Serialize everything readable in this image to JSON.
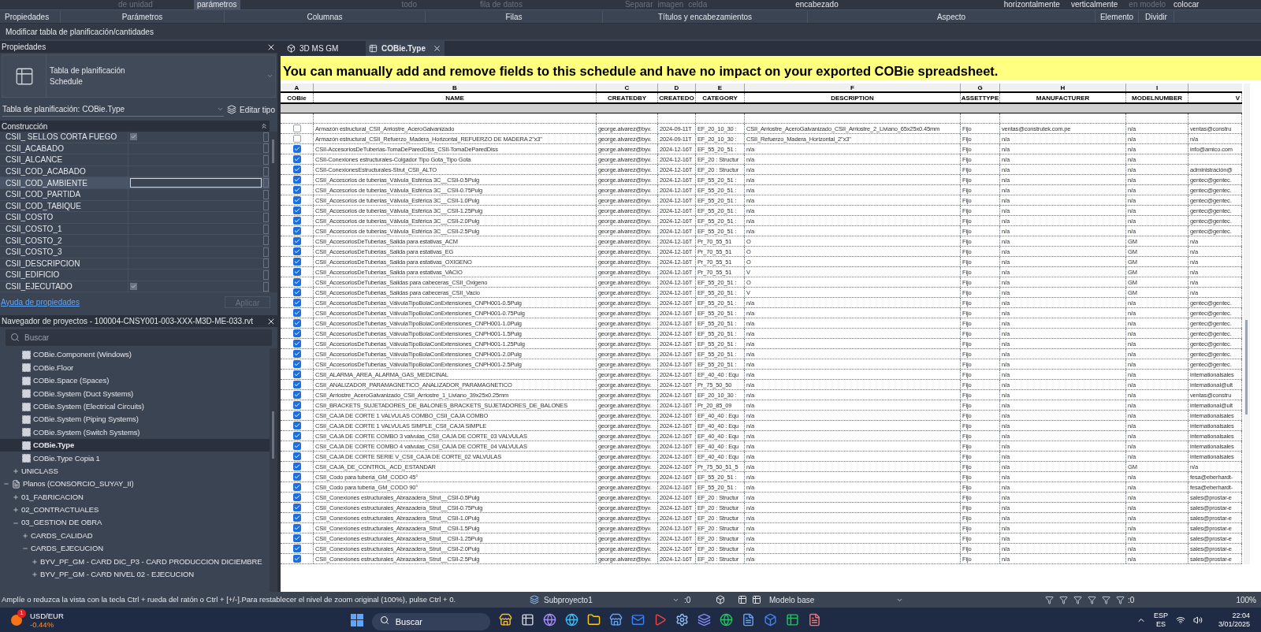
{
  "ribbon": {
    "tools": [
      {
        "label": "de unidad",
        "disabled": true,
        "selected": false
      },
      {
        "label": "parámetros",
        "disabled": false,
        "selected": true
      },
      {
        "label": "todo",
        "disabled": true,
        "selected": false
      },
      {
        "label": "fila de datos",
        "disabled": true,
        "selected": false
      },
      {
        "label": "Separar",
        "disabled": true,
        "selected": false
      },
      {
        "label": "imagen",
        "disabled": true,
        "selected": false
      },
      {
        "label": "celda",
        "disabled": true,
        "selected": false
      },
      {
        "label": "encabezado",
        "disabled": false,
        "selected": false
      },
      {
        "label": "horizontalmente",
        "disabled": false,
        "selected": false
      },
      {
        "label": "verticalmente",
        "disabled": false,
        "selected": false
      },
      {
        "label": "en modelo",
        "disabled": true,
        "selected": false
      },
      {
        "label": "colocar",
        "disabled": false,
        "selected": false
      }
    ],
    "panels": [
      "Propiedades",
      "Parámetros",
      "Columnas",
      "Filas",
      "Títulos y encabezamientos",
      "Aspecto",
      "Elemento",
      "Dividir"
    ],
    "context": "Modificar tabla de planificación/cantidades"
  },
  "properties": {
    "title": "Propiedades",
    "type_name": "Tabla de planificación",
    "type_sub": "Schedule",
    "selector": "Tabla de planificación: COBie.Type",
    "edit_type": "Editar tipo",
    "group": "Construcción",
    "rows": [
      {
        "label": "CSII_ SELLOS CORTA FUEGO",
        "kind": "checkbox",
        "checked": true,
        "selected": false
      },
      {
        "label": "CSII_ACABADO",
        "kind": "text",
        "selected": false
      },
      {
        "label": "CSII_ALCANCE",
        "kind": "text",
        "selected": false
      },
      {
        "label": "CSII_COD_ACABADO",
        "kind": "text",
        "selected": false
      },
      {
        "label": "CSII_COD_AMBIENTE",
        "kind": "text",
        "selected": true
      },
      {
        "label": "CSII_COD_PARTIDA",
        "kind": "text",
        "selected": false
      },
      {
        "label": "CSII_COD_TABIQUE",
        "kind": "text",
        "selected": false
      },
      {
        "label": "CSII_COSTO",
        "kind": "text",
        "selected": false
      },
      {
        "label": "CSII_COSTO_1",
        "kind": "text",
        "selected": false
      },
      {
        "label": "CSII_COSTO_2",
        "kind": "text",
        "selected": false
      },
      {
        "label": "CSII_COSTO_3",
        "kind": "text",
        "selected": false
      },
      {
        "label": "CSII_DESCRIPCION",
        "kind": "text",
        "selected": false
      },
      {
        "label": "CSII_EDIFICIO",
        "kind": "text",
        "selected": false
      },
      {
        "label": "CSII_EJECUTADO",
        "kind": "checkbox",
        "checked": true,
        "selected": false
      }
    ],
    "help_link": "Ayuda de propiedades",
    "apply": {
      "label": "Aplicar",
      "disabled": true
    }
  },
  "browser": {
    "title": "Navegador de proyectos - 100004-CNSY001-003-XXX-M3D-ME-033.rvt",
    "search": {
      "placeholder": "Buscar"
    },
    "tree": [
      {
        "children": [
          {
            "children": [
              {
                "label": "COBie.Component (Windows)",
                "kind": "schedule",
                "selected": false
              },
              {
                "label": "COBie.Floor",
                "kind": "schedule",
                "selected": false
              },
              {
                "label": "COBie.Space (Spaces)",
                "kind": "schedule",
                "selected": false
              },
              {
                "label": "COBie.System (Duct Systems)",
                "kind": "schedule",
                "selected": false
              },
              {
                "label": "COBie.System (Electrical Circuits)",
                "kind": "schedule",
                "selected": false
              },
              {
                "label": "COBie.System (Piping Systems)",
                "kind": "schedule",
                "selected": false
              },
              {
                "label": "COBie.System (Switch Systems)",
                "kind": "schedule",
                "selected": false
              },
              {
                "label": "COBie.Type",
                "kind": "schedule",
                "selected": true
              },
              {
                "label": "COBie.Type Copia 1",
                "kind": "schedule",
                "selected": false
              }
            ]
          },
          {
            "label": "UNICLASS",
            "expanded": false,
            "selected": false
          }
        ]
      },
      {
        "label": "Planos (CONSORCIO_SUYAY_II)",
        "kind": "sheets",
        "expanded": true,
        "selected": false,
        "children": [
          {
            "label": "01_FABRICACION",
            "expanded": false,
            "selected": false
          },
          {
            "label": "02_CONTRACTUALES",
            "expanded": false,
            "selected": false
          },
          {
            "label": "03_GESTION DE OBRA",
            "expanded": true,
            "selected": false,
            "children": [
              {
                "label": "CARDS_CALIDAD",
                "expanded": false,
                "selected": false
              },
              {
                "label": "CARDS_EJECUCION",
                "expanded": true,
                "selected": false,
                "children": [
                  {
                    "label": "BYV_PF_GM - CARD DIC_P3 - CARD PRODUCCION DICIEMBRE",
                    "expanded": false,
                    "selected": false
                  },
                  {
                    "label": "BYV_PF_GM - CARD NIVEL 02 - EJECUCION",
                    "expanded": false,
                    "selected": false
                  }
                ]
              }
            ]
          }
        ]
      }
    ]
  },
  "view_tabs": [
    {
      "label": "3D MS GM",
      "selected": false
    },
    {
      "label": "COBie.Type",
      "selected": true
    }
  ],
  "schedule": {
    "banner": "You can manually add and remove fields to this schedule and have no impact on your exported COBie spreadsheet.",
    "columns": [
      {
        "letter": "A",
        "heading": "COBie"
      },
      {
        "letter": "B",
        "heading": "NAME"
      },
      {
        "letter": "C",
        "heading": "CREATEDBY"
      },
      {
        "letter": "D",
        "heading": "CREATEDO"
      },
      {
        "letter": "E",
        "heading": "CATEGORY"
      },
      {
        "letter": "F",
        "heading": "DESCRIPTION"
      },
      {
        "letter": "G",
        "heading": "ASSETTYPE"
      },
      {
        "letter": "H",
        "heading": "MANUFACTURER"
      },
      {
        "letter": "I",
        "heading": "MODELNUMBER"
      },
      {
        "heading": "V"
      }
    ],
    "rows": [
      {
        "checked": false,
        "name": "Armazón estructural_CSII_Arriostre_AceroGalvanizado",
        "createdby": "george.alvarez@byv.",
        "createdon": "2024-09-11T",
        "category": "EF_20_10_30 :",
        "description": "CSII_Arriostre_AceroGalvanizado_CSII_Arriostre_2_Liviano_65x25x0.45mm",
        "assettype": "Fijo",
        "manufacturer": "ventas@construtek.com.pe",
        "modelnumber": "n/a",
        "column_10": "ventas@constru"
      },
      {
        "checked": false,
        "name": "Armazón estructural_CSII_Refuerzo_Madera_Horizontal_REFUERZO DE MADERA 2\"x3\"",
        "createdby": "george.alvarez@byv.",
        "createdon": "2024-09-11T",
        "category": "EF_20_10_30 :",
        "description": "CSII_Refuerzo_Madera_Horizontal_2\"x3\"",
        "assettype": "Fijo",
        "manufacturer": "n/a",
        "modelnumber": "n/a",
        "column_10": "n/a"
      },
      {
        "checked": true,
        "name": "CSII-AccesoriosDeTuberias-TomaDeParedDiss_CSII-TomaDeParedDiss",
        "createdby": "george.alvarez@byv.",
        "createdon": "2024-12-16T",
        "category": "EF_55_20_51 :",
        "description": "n/a",
        "assettype": "Fijo",
        "manufacturer": "n/a",
        "modelnumber": "n/a",
        "column_10": "info@amico.com"
      },
      {
        "checked": true,
        "name": "CSII-Conexiones estructurales-Colgador Tipo Gota_Tipo Gota",
        "createdby": "george.alvarez@byv.",
        "createdon": "2024-12-16T",
        "category": "EF_20 : Structur",
        "description": "n/a",
        "assettype": "Fijo",
        "manufacturer": "n/a",
        "modelnumber": "n/a"
      },
      {
        "checked": true,
        "name": "CSII-ConexionesEstructurales-Strut_CSII_ALTO",
        "createdby": "george.alvarez@byv.",
        "createdon": "2024-12-16T",
        "category": "EF_20 : Structur",
        "description": "n/a",
        "assettype": "Fijo",
        "manufacturer": "n/a",
        "modelnumber": "n/a",
        "column_10": "administración@"
      },
      {
        "checked": true,
        "name": "CSII_Accesorios de tuberias_Válvula_Esférica 3C__CSII-0.5Pulg",
        "createdby": "george.alvarez@byv.",
        "createdon": "2024-12-16T",
        "category": "EF_55_20_51 :",
        "description": "n/a",
        "assettype": "Fijo",
        "manufacturer": "n/a",
        "modelnumber": "n/a",
        "column_10": "gentec@gentec."
      },
      {
        "checked": true,
        "name": "CSII_Accesorios de tuberias_Válvula_Esférica 3C__CSII-0.75Pulg",
        "createdby": "george.alvarez@byv.",
        "createdon": "2024-12-16T",
        "category": "EF_55_20_51 :",
        "description": "n/a",
        "assettype": "Fijo",
        "manufacturer": "n/a",
        "modelnumber": "n/a",
        "column_10": "gentec@gentec."
      },
      {
        "checked": true,
        "name": "CSII_Accesorios de tuberias_Válvula_Esférica 3C__CSII-1.0Pulg",
        "createdby": "george.alvarez@byv.",
        "createdon": "2024-12-16T",
        "category": "EF_55_20_51 :",
        "description": "n/a",
        "assettype": "Fijo",
        "manufacturer": "n/a",
        "modelnumber": "n/a",
        "column_10": "gentec@gentec."
      },
      {
        "checked": true,
        "name": "CSII_Accesorios de tuberias_Válvula_Esférica 3C__CSII-1.25Pulg",
        "createdby": "george.alvarez@byv.",
        "createdon": "2024-12-16T",
        "category": "EF_55_20_51 :",
        "description": "n/a",
        "assettype": "Fijo",
        "manufacturer": "n/a",
        "modelnumber": "n/a",
        "column_10": "gentec@gentec."
      },
      {
        "checked": true,
        "name": "CSII_Accesorios de tuberias_Válvula_Esférica 3C__CSII-2.0Pulg",
        "createdby": "george.alvarez@byv.",
        "createdon": "2024-12-16T",
        "category": "EF_55_20_51 :",
        "description": "n/a",
        "assettype": "Fijo",
        "manufacturer": "n/a",
        "modelnumber": "n/a",
        "column_10": "gentec@gentec."
      },
      {
        "checked": true,
        "name": "CSII_Accesorios de tuberias_Válvula_Esférica 3C__CSII-2.5Pulg",
        "createdby": "george.alvarez@byv.",
        "createdon": "2024-12-16T",
        "category": "EF_55_20_51 :",
        "description": "n/a",
        "assettype": "Fijo",
        "manufacturer": "n/a",
        "modelnumber": "n/a",
        "column_10": "gentec@gentec."
      },
      {
        "checked": true,
        "name": "CSII_AccesoriosDeTuberias_Salida para estativas_ACM",
        "createdby": "george.alvarez@byv.",
        "createdon": "2024-12-16T",
        "category": "Pr_70_55_51",
        "description": "O",
        "assettype": "Fijo",
        "manufacturer": "n/a",
        "modelnumber": "GM",
        "column_10": "n/a"
      },
      {
        "checked": true,
        "name": "CSII_AccesoriosDeTuberias_Salida para estativas_EG",
        "createdby": "george.alvarez@byv.",
        "createdon": "2024-12-16T",
        "category": "Pr_70_55_51",
        "description": "O",
        "assettype": "Fijo",
        "manufacturer": "n/a",
        "modelnumber": "GM",
        "column_10": "n/a"
      },
      {
        "checked": true,
        "name": "CSII_AccesoriosDeTuberias_Salida para estativas_OXIGENO",
        "createdby": "george.alvarez@byv.",
        "createdon": "2024-12-16T",
        "category": "Pr_70_55_51",
        "description": "O",
        "assettype": "Fijo",
        "manufacturer": "n/a",
        "modelnumber": "GM",
        "column_10": "n/a"
      },
      {
        "checked": true,
        "name": "CSII_AccesoriosDeTuberias_Salida para estativas_VACIO",
        "createdby": "george.alvarez@byv.",
        "createdon": "2024-12-16T",
        "category": "Pr_70_55_51",
        "description": "V",
        "assettype": "Fijo",
        "manufacturer": "n/a",
        "modelnumber": "GM",
        "column_10": "n/a"
      },
      {
        "checked": true,
        "name": "CSII_AccesoriosDeTuberias_Salidas para cabeceras_CSII_Oxigeno",
        "createdby": "george.alvarez@byv.",
        "createdon": "2024-12-16T",
        "category": "EF_55_20_51 :",
        "description": "O",
        "assettype": "Fijo",
        "manufacturer": "n/a",
        "modelnumber": "GM",
        "column_10": "n/a"
      },
      {
        "checked": true,
        "name": "CSII_AccesoriosDeTuberias_Salidas para cabeceras_CSII_Vacio",
        "createdby": "george.alvarez@byv.",
        "createdon": "2024-12-16T",
        "category": "EF_55_20_51 :",
        "description": "V",
        "assettype": "Fijo",
        "manufacturer": "n/a",
        "modelnumber": "GM",
        "column_10": "n/a"
      },
      {
        "checked": true,
        "name": "CSII_AccesoriosDeTuberias_VálvulaTipoBolaConExtensiones_CNPH001-0.5Pulg",
        "createdby": "george.alvarez@byv.",
        "createdon": "2024-12-16T",
        "category": "EF_55_20_51 :",
        "description": "n/a",
        "assettype": "Fijo",
        "manufacturer": "n/a",
        "modelnumber": "n/a",
        "column_10": "gentec@gentec."
      },
      {
        "checked": true,
        "name": "CSII_AccesoriosDeTuberias_VálvulaTipoBolaConExtensiones_CNPH001-0.75Pulg",
        "createdby": "george.alvarez@byv.",
        "createdon": "2024-12-16T",
        "category": "EF_55_20_51 :",
        "description": "n/a",
        "assettype": "Fijo",
        "manufacturer": "n/a",
        "modelnumber": "n/a",
        "column_10": "gentec@gentec."
      },
      {
        "checked": true,
        "name": "CSII_AccesoriosDeTuberias_VálvulaTipoBolaConExtensiones_CNPH001-1.0Pulg",
        "createdby": "george.alvarez@byv.",
        "createdon": "2024-12-16T",
        "category": "EF_55_20_51 :",
        "description": "n/a",
        "assettype": "Fijo",
        "manufacturer": "n/a",
        "modelnumber": "n/a",
        "column_10": "gentec@gentec."
      },
      {
        "checked": true,
        "name": "CSII_AccesoriosDeTuberias_VálvulaTipoBolaConExtensiones_CNPH001-1.5Pulg",
        "createdby": "george.alvarez@byv.",
        "createdon": "2024-12-16T",
        "category": "EF_55_20_51 :",
        "description": "n/a",
        "assettype": "Fijo",
        "manufacturer": "n/a",
        "modelnumber": "n/a",
        "column_10": "gentec@gentec."
      },
      {
        "checked": true,
        "name": "CSII_AccesoriosDeTuberias_VálvulaTipoBolaConExtensiones_CNPH001-1.25Pulg",
        "createdby": "george.alvarez@byv.",
        "createdon": "2024-12-16T",
        "category": "EF_55_20_51 :",
        "description": "n/a",
        "assettype": "Fijo",
        "manufacturer": "n/a",
        "modelnumber": "n/a",
        "column_10": "gentec@gentec."
      },
      {
        "checked": true,
        "name": "CSII_AccesoriosDeTuberias_VálvulaTipoBolaConExtensiones_CNPH001-2.0Pulg",
        "createdby": "george.alvarez@byv.",
        "createdon": "2024-12-16T",
        "category": "EF_55_20_51 :",
        "description": "n/a",
        "assettype": "Fijo",
        "manufacturer": "n/a",
        "modelnumber": "n/a",
        "column_10": "gentec@gentec."
      },
      {
        "checked": true,
        "name": "CSII_AccesoriosDeTuberias_VálvulaTipoBolaConExtensiones_CNPH001-2.5Pulg",
        "createdby": "george.alvarez@byv.",
        "createdon": "2024-12-16T",
        "category": "EF_55_20_51 :",
        "description": "n/a",
        "assettype": "Fijo",
        "manufacturer": "n/a",
        "modelnumber": "n/a",
        "column_10": "gentec@gentec."
      },
      {
        "checked": true,
        "name": "CSII_ALARMA_AREA_ALARMA_GAS_MEDICINAL",
        "createdby": "george.alvarez@byv.",
        "createdon": "2024-12-16T",
        "category": "EF_40_40 : Equ",
        "description": "n/a",
        "assettype": "Fijo",
        "manufacturer": "n/a",
        "modelnumber": "n/a",
        "column_10": "internationalsales"
      },
      {
        "checked": true,
        "name": "CSII_ANALIZADOR_PARAMAGNETICO_ANALIZADOR_PARAMAGNETICO",
        "createdby": "george.alvarez@byv.",
        "createdon": "2024-12-16T",
        "category": "Pr_75_50_50",
        "description": "n/a",
        "assettype": "Fijo",
        "manufacturer": "n/a",
        "modelnumber": "n/a",
        "column_10": "international@ult"
      },
      {
        "checked": true,
        "name": "CSII_Arriostre_AceroGalvanizado_CSII_Arriostre_1_Liviano_39x25x0.25mm",
        "createdby": "george.alvarez@byv.",
        "createdon": "2024-12-16T",
        "category": "EF_20_10_30 :",
        "description": "n/a",
        "assettype": "Fijo",
        "manufacturer": "n/a",
        "modelnumber": "n/a",
        "column_10": "ventas@constru"
      },
      {
        "checked": true,
        "name": "CSII_BRACKETS_SUJETADORES_DE_BALONES_BRACKETS_SUJETADORES_DE_BALONES",
        "createdby": "george.alvarez@byv.",
        "createdon": "2024-12-16T",
        "category": "Pr_20_85_09",
        "description": "n/a",
        "assettype": "Fijo",
        "manufacturer": "n/a",
        "modelnumber": "n/a",
        "column_10": "international@ult"
      },
      {
        "checked": true,
        "name": "CSII_CAJA DE CORTE 1 VALVULAS COMBO_CSII_CAJA COMBO",
        "createdby": "george.alvarez@byv.",
        "createdon": "2024-12-16T",
        "category": "EF_40_40 : Equ",
        "description": "n/a",
        "assettype": "Fijo",
        "manufacturer": "n/a",
        "modelnumber": "n/a",
        "column_10": "internationalsales"
      },
      {
        "checked": true,
        "name": "CSII_CAJA DE CORTE 1 VALVULAS SIMPLE_CSII_CAJA SIMPLE",
        "createdby": "george.alvarez@byv.",
        "createdon": "2024-12-16T",
        "category": "EF_40_40 : Equ",
        "description": "n/a",
        "assettype": "Fijo",
        "manufacturer": "n/a",
        "modelnumber": "n/a",
        "column_10": "internationalsales"
      },
      {
        "checked": true,
        "name": "CSII_CAJA DE CORTE COMBO 3 valvulas_CSII_CAJA DE CORTE_03 VALVULAS",
        "createdby": "george.alvarez@byv.",
        "createdon": "2024-12-16T",
        "category": "EF_40_40 : Equ",
        "description": "n/a",
        "assettype": "Fijo",
        "manufacturer": "n/a",
        "modelnumber": "n/a",
        "column_10": "internationalsales"
      },
      {
        "checked": true,
        "name": "CSII_CAJA DE CORTE COMBO 4 valvulas_CSII_CAJA DE CORTE_04 VALVULAS",
        "createdby": "george.alvarez@byv.",
        "createdon": "2024-12-16T",
        "category": "EF_40_40 : Equ",
        "description": "n/a",
        "assettype": "Fijo",
        "manufacturer": "n/a",
        "modelnumber": "n/a",
        "column_10": "internationalsales"
      },
      {
        "checked": true,
        "name": "CSII_CAJA DE CORTE SERIE V_CSII_CAJA DE CORTE_02 VALVULAS",
        "createdby": "george.alvarez@byv.",
        "createdon": "2024-12-16T",
        "category": "EF_40_40 : Equ",
        "description": "n/a",
        "assettype": "Fijo",
        "manufacturer": "n/a",
        "modelnumber": "n/a",
        "column_10": "internationalsales"
      },
      {
        "checked": true,
        "name": "CSII_CAJA_DE_CONTROL_ACD_ESTANDAR",
        "createdby": "george.alvarez@byv.",
        "createdon": "2024-12-16T",
        "category": "Pr_75_50_51_5",
        "description": "n/a",
        "assettype": "Fijo",
        "manufacturer": "n/a",
        "modelnumber": "GM",
        "column_10": "n/a"
      },
      {
        "checked": true,
        "name": "CSII_Codo para tuberia_GM_CODO 45°",
        "createdby": "george.alvarez@byv.",
        "createdon": "2024-12-16T",
        "category": "EF_55_20_51 :",
        "description": "n/a",
        "assettype": "Fijo",
        "manufacturer": "n/a",
        "modelnumber": "n/a",
        "column_10": "fesa@eberhardt-"
      },
      {
        "checked": true,
        "name": "CSII_Codo para tuberia_GM_CODO 90°",
        "createdby": "george.alvarez@byv.",
        "createdon": "2024-12-16T",
        "category": "EF_55_20_51 :",
        "description": "n/a",
        "assettype": "Fijo",
        "manufacturer": "n/a",
        "modelnumber": "n/a",
        "column_10": "fesa@eberhardt-"
      },
      {
        "checked": true,
        "name": "CSII_Conexiones estructurales_Abrazadera_Strut__CSII-0.5Pulg",
        "createdby": "george.alvarez@byv.",
        "createdon": "2024-12-16T",
        "category": "EF_20 : Structur",
        "description": "n/a",
        "assettype": "Fijo",
        "manufacturer": "n/a",
        "modelnumber": "n/a",
        "column_10": "sales@prostar-e"
      },
      {
        "checked": true,
        "name": "CSII_Conexiones estructurales_Abrazadera_Strut__CSII-0.75Pulg",
        "createdby": "george.alvarez@byv.",
        "createdon": "2024-12-16T",
        "category": "EF_20 : Structur",
        "description": "n/a",
        "assettype": "Fijo",
        "manufacturer": "n/a",
        "modelnumber": "n/a",
        "column_10": "sales@prostar-e"
      },
      {
        "checked": true,
        "name": "CSII_Conexiones estructurales_Abrazadera_Strut__CSII-1.0Pulg",
        "createdby": "george.alvarez@byv.",
        "createdon": "2024-12-16T",
        "category": "EF_20 : Structur",
        "description": "n/a",
        "assettype": "Fijo",
        "manufacturer": "n/a",
        "modelnumber": "n/a",
        "column_10": "sales@prostar-e"
      },
      {
        "checked": true,
        "name": "CSII_Conexiones estructurales_Abrazadera_Strut__CSII-1.5Pulg",
        "createdby": "george.alvarez@byv.",
        "createdon": "2024-12-16T",
        "category": "EF_20 : Structur",
        "description": "n/a",
        "assettype": "Fijo",
        "manufacturer": "n/a",
        "modelnumber": "n/a",
        "column_10": "sales@prostar-e"
      },
      {
        "checked": true,
        "name": "CSII_Conexiones estructurales_Abrazadera_Strut__CSII-1.25Pulg",
        "createdby": "george.alvarez@byv.",
        "createdon": "2024-12-16T",
        "category": "EF_20 : Structur",
        "description": "n/a",
        "assettype": "Fijo",
        "manufacturer": "n/a",
        "modelnumber": "n/a",
        "column_10": "sales@prostar-e"
      },
      {
        "checked": true,
        "name": "CSII_Conexiones estructurales_Abrazadera_Strut__CSII-2.0Pulg",
        "createdby": "george.alvarez@byv.",
        "createdon": "2024-12-16T",
        "category": "EF_20 : Structur",
        "description": "n/a",
        "assettype": "Fijo",
        "manufacturer": "n/a",
        "modelnumber": "n/a",
        "column_10": "sales@prostar-e"
      },
      {
        "checked": true,
        "name": "CSII_Conexiones estructurales_Abrazadera_Strut__CSII-2.5Pulg",
        "createdby": "george.alvarez@byv.",
        "createdon": "2024-12-16T",
        "category": "EF_20 : Structur",
        "description": "n/a",
        "assettype": "Fijo",
        "manufacturer": "n/a",
        "modelnumber": "n/a",
        "column_10": "sales@prostar-e"
      }
    ]
  },
  "status_bar": {
    "message": "Amplíe o reduzca la vista con la tecla Ctrl + rueda del ratón o Ctrl + [+/-].Para restablecer el nivel de zoom original (100%), pulse Ctrl + 0.",
    "workset": "Subproyecto1",
    "workset_count": ":0",
    "design_option": "Modelo base",
    "filter_count": ":0",
    "zoom": "100%"
  },
  "taskbar": {
    "ticker": {
      "badge": "1",
      "symbol": "USD/EUR",
      "change": "-0.44%"
    },
    "search": {
      "placeholder": "Buscar"
    },
    "language": "ESP",
    "layout": "ES",
    "time": "22:04",
    "date": "3/01/2025"
  }
}
